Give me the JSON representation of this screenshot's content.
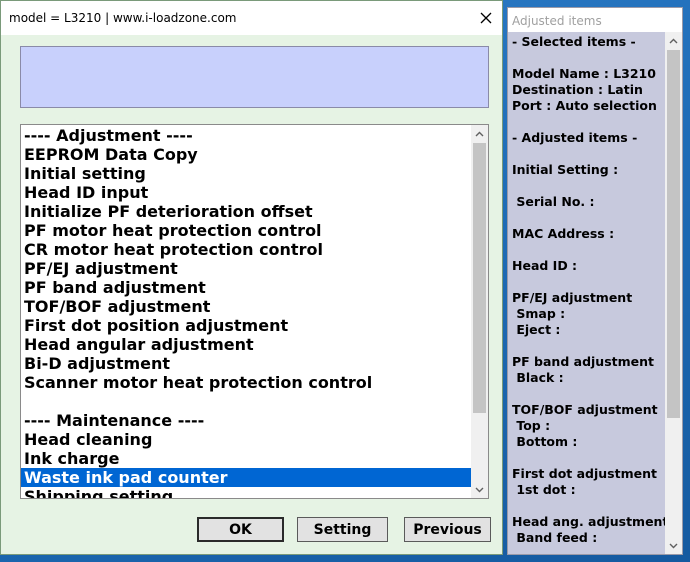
{
  "main_window": {
    "title": "model = L3210 | www.i-loadzone.com",
    "message": "",
    "list_items": [
      {
        "label": "---- Adjustment ----",
        "selected": false
      },
      {
        "label": "EEPROM Data Copy",
        "selected": false
      },
      {
        "label": "Initial setting",
        "selected": false
      },
      {
        "label": "Head ID input",
        "selected": false
      },
      {
        "label": "Initialize PF deterioration offset",
        "selected": false
      },
      {
        "label": "PF motor heat protection control",
        "selected": false
      },
      {
        "label": "CR motor heat protection control",
        "selected": false
      },
      {
        "label": "PF/EJ adjustment",
        "selected": false
      },
      {
        "label": "PF band adjustment",
        "selected": false
      },
      {
        "label": "TOF/BOF adjustment",
        "selected": false
      },
      {
        "label": "First dot position adjustment",
        "selected": false
      },
      {
        "label": "Head angular adjustment",
        "selected": false
      },
      {
        "label": "Bi-D adjustment",
        "selected": false
      },
      {
        "label": "Scanner motor heat protection control",
        "selected": false
      },
      {
        "label": "",
        "selected": false
      },
      {
        "label": "---- Maintenance ----",
        "selected": false
      },
      {
        "label": "Head cleaning",
        "selected": false
      },
      {
        "label": "Ink charge",
        "selected": false
      },
      {
        "label": "Waste ink pad counter",
        "selected": true
      },
      {
        "label": "Shipping setting",
        "selected": false
      }
    ],
    "buttons": {
      "ok": "OK",
      "setting": "Setting",
      "previous": "Previous"
    }
  },
  "side_window": {
    "title": "Adjusted items",
    "lines": [
      "- Selected items -",
      "",
      "Model Name : L3210",
      "Destination : Latin",
      "Port : Auto selection",
      "",
      "- Adjusted items -",
      "",
      "Initial Setting :",
      "",
      " Serial No. :",
      "",
      "MAC Address :",
      "",
      "Head ID :",
      "",
      "PF/EJ adjustment",
      " Smap :",
      " Eject :",
      "",
      "PF band adjustment",
      " Black :",
      "",
      "TOF/BOF adjustment",
      " Top :",
      " Bottom :",
      "",
      "First dot adjustment",
      " 1st dot :",
      "",
      "Head ang. adjustment",
      " Band feed :"
    ]
  },
  "colors": {
    "window_bg": "#e6f3e4",
    "message_bg": "#c8d0fc",
    "selection": "#0066d3",
    "side_bg": "#c7c9dd"
  },
  "icons": {
    "close": "close-icon",
    "scroll_up": "chevron-up-icon",
    "scroll_down": "chevron-down-icon"
  }
}
